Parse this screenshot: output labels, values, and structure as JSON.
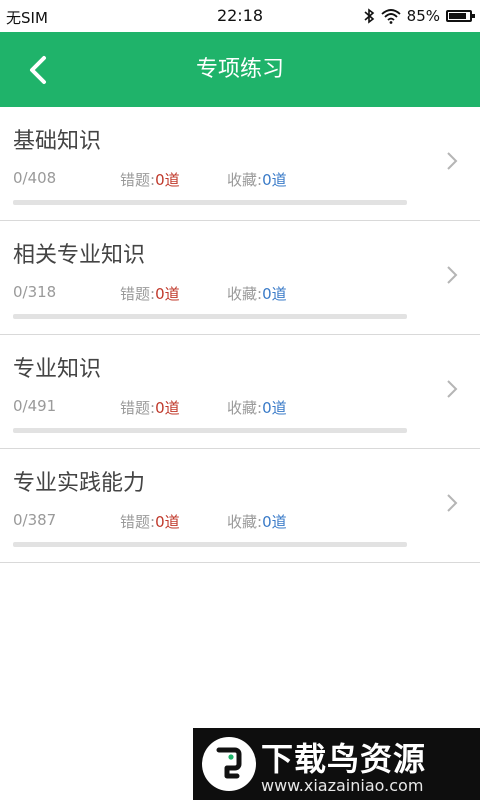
{
  "status_bar": {
    "carrier": "无SIM",
    "time": "22:18",
    "battery": "85%",
    "battery_level": 0.85
  },
  "header": {
    "title": "专项练习",
    "back_icon": "chevron-left-icon"
  },
  "items": [
    {
      "name": "基础知识",
      "count": "0/408",
      "wrong_label": "错题:",
      "wrong_value": "0道",
      "fav_label": "收藏:",
      "fav_value": "0道",
      "progress": 0
    },
    {
      "name": "相关专业知识",
      "count": "0/318",
      "wrong_label": "错题:",
      "wrong_value": "0道",
      "fav_label": "收藏:",
      "fav_value": "0道",
      "progress": 0
    },
    {
      "name": "专业知识",
      "count": "0/491",
      "wrong_label": "错题:",
      "wrong_value": "0道",
      "fav_label": "收藏:",
      "fav_value": "0道",
      "progress": 0
    },
    {
      "name": "专业实践能力",
      "count": "0/387",
      "wrong_label": "错题:",
      "wrong_value": "0道",
      "fav_label": "收藏:",
      "fav_value": "0道",
      "progress": 0
    }
  ],
  "watermark": {
    "title": "下载鸟资源",
    "url": "www.xiazainiao.com"
  },
  "colors": {
    "header_green": "#1fb36a",
    "wrong_red": "#c0392b",
    "fav_blue": "#3a7bc8"
  }
}
